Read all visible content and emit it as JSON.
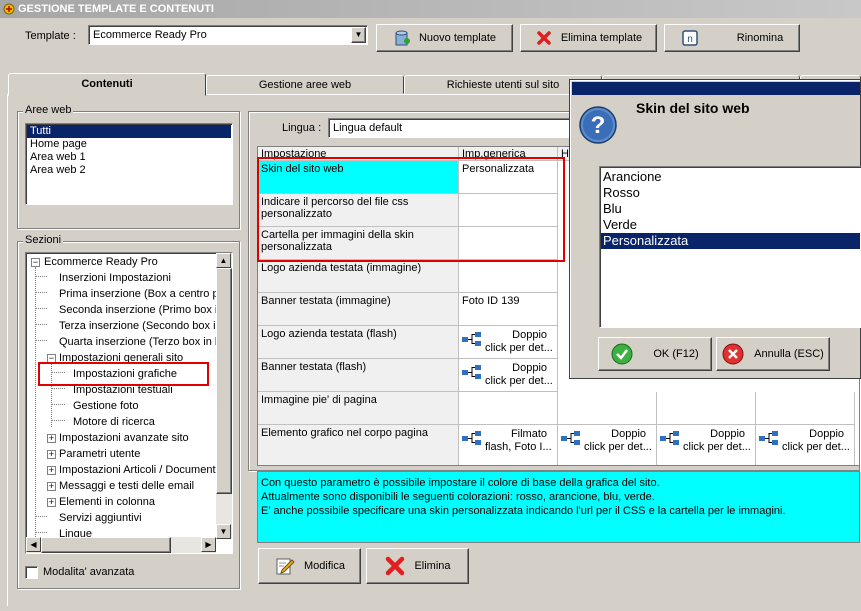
{
  "window": {
    "title": "GESTIONE TEMPLATE E CONTENUTI"
  },
  "toolbar": {
    "template_label": "Template :",
    "template_value": "Ecommerce Ready Pro",
    "new_template": "Nuovo template",
    "delete_template": "Elimina template",
    "rename": "Rinomina"
  },
  "tabs": [
    "Contenuti",
    "Gestione aree web",
    "Richieste utenti sul sito"
  ],
  "aree_web": {
    "label": "Aree web",
    "items": [
      "Tutti",
      "Home page",
      "Area web 1",
      "Area web 2"
    ],
    "selected": "Tutti"
  },
  "sezioni": {
    "label": "Sezioni",
    "root": "Ecommerce Ready Pro",
    "items": [
      "Inserzioni Impostazioni",
      "Prima inserzione (Box a centro pa",
      "Seconda inserzione (Primo box in",
      "Terza inserzione (Secondo box in",
      "Quarta inserzione (Terzo box in b",
      "Impostazioni generali sito",
      "Impostazioni grafiche",
      "Impostazioni testuali",
      "Gestione foto",
      "Motore di ricerca",
      "Impostazioni avanzate sito",
      "Parametri utente",
      "Impostazioni Articoli / Documenti",
      "Messaggi e testi delle email",
      "Elementi in colonna",
      "Servizi aggiuntivi",
      "Lingue"
    ]
  },
  "modalita_avanzata": "Modalita' avanzata",
  "lingua": {
    "label": "Lingua :",
    "value": "Lingua default"
  },
  "grid": {
    "headers": [
      "Impostazione",
      "Imp.generica",
      "H"
    ],
    "rows": [
      {
        "name": "Skin del sito web",
        "value": "Personalizzata"
      },
      {
        "name": "Indicare il percorso del file css personalizzato",
        "value": ""
      },
      {
        "name": "Cartella per immagini della skin personalizzata",
        "value": ""
      },
      {
        "name": "Logo azienda testata (immagine)",
        "value": ""
      },
      {
        "name": "Banner testata (immagine)",
        "value": "Foto ID 139"
      },
      {
        "name": "Logo azienda testata (flash)",
        "value_l1": "Doppio",
        "value_l2": "click per det..."
      },
      {
        "name": "Banner testata (flash)",
        "value_l1": "Doppio",
        "value_l2": "click per det..."
      },
      {
        "name": "Immagine pie' di pagina",
        "value": ""
      },
      {
        "name": "Elemento grafico nel corpo pagina",
        "value_l1": "Filmato",
        "value_l2": "flash, Foto I..."
      }
    ],
    "extra_cells": [
      {
        "l1": "Doppio",
        "l2": "click per det..."
      },
      {
        "l1": "Doppio",
        "l2": "click per det..."
      },
      {
        "l1": "Doppio",
        "l2": "click per det..."
      }
    ]
  },
  "description": [
    "Con questo parametro è possibile impostare il colore di base della grafica del sito.",
    "Attualmente sono disponibili le seguenti colorazioni: rosso, arancione, blu, verde.",
    "E' anche possibile specificare una skin personalizzata indicando l'url per il CSS e la cartella per le immagini."
  ],
  "bottom_buttons": {
    "modify": "Modifica",
    "delete": "Elimina"
  },
  "dialog": {
    "title": "Skin del sito web",
    "options": [
      "Arancione",
      "Rosso",
      "Blu",
      "Verde",
      "Personalizzata"
    ],
    "selected": "Personalizzata",
    "ok": "OK (F12)",
    "cancel": "Annulla (ESC)"
  },
  "colors": {
    "highlight_cyan": "#00ffff",
    "selection": "#0a246a",
    "annotation_red": "#e00000"
  }
}
